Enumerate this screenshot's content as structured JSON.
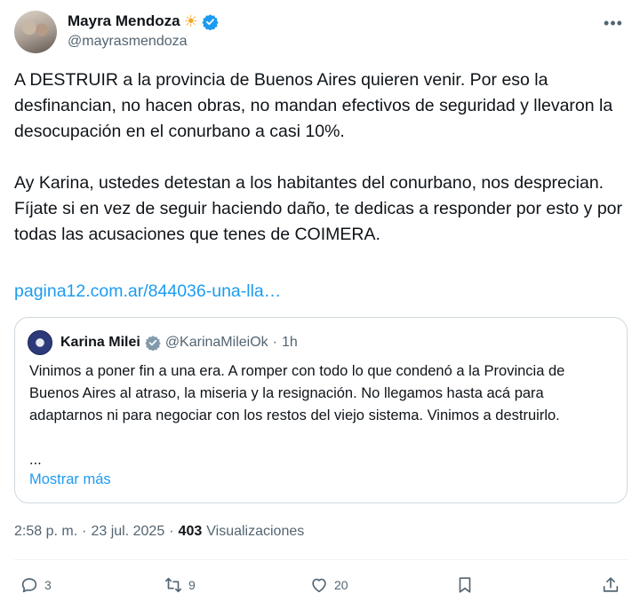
{
  "author": {
    "display_name": "Mayra Mendoza",
    "name_emoji": "☀",
    "handle": "@mayrasmendoza",
    "verified": true
  },
  "tweet": {
    "paragraph1": "A DESTRUIR a la provincia de Buenos Aires quieren venir. Por eso la desfinancian, no hacen obras, no mandan efectivos de seguridad y llevaron la desocupación en el conurbano a casi 10%.",
    "paragraph2": "Ay Karina, ustedes detestan a los habitantes del conurbano, nos desprecian. Fíjate si en vez de seguir haciendo daño, te dedicas a responder por esto y por todas las acusaciones que tenes de COIMERA.",
    "link": "pagina12.com.ar/844036-una-lla…"
  },
  "quote": {
    "display_name": "Karina Milei",
    "handle": "@KarinaMileiOk",
    "separator": "·",
    "time": "1h",
    "text": "Vinimos a poner fin a una era. A romper con todo lo que condenó a la Provincia de Buenos Aires al atraso, la miseria y la resignación. No llegamos hasta acá para adaptarnos ni para negociar con los restos del viejo sistema. Vinimos a destruirlo.",
    "ellipsis": "...",
    "show_more": "Mostrar más"
  },
  "meta": {
    "time": "2:58 p. m.",
    "separator1": "·",
    "date": "23 jul. 2025",
    "separator2": "·",
    "views_count": "403",
    "views_label": "Visualizaciones"
  },
  "actions": {
    "replies": "3",
    "reposts": "9",
    "likes": "20"
  },
  "colors": {
    "accent": "#1d9bf0",
    "secondary_text": "#536471",
    "verified_blue": "#1d9bf0",
    "verified_gray": "#829aab"
  }
}
